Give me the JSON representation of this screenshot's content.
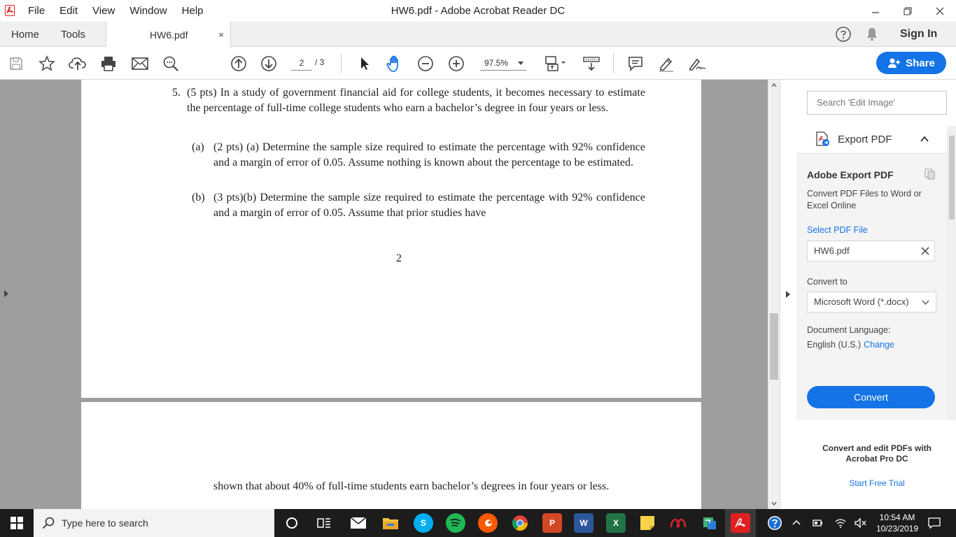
{
  "window": {
    "title": "HW6.pdf - Adobe Acrobat Reader DC",
    "menu": [
      "File",
      "Edit",
      "View",
      "Window",
      "Help"
    ]
  },
  "tabs": {
    "home": "Home",
    "tools": "Tools",
    "document": "HW6.pdf",
    "close_glyph": "×",
    "sign_in": "Sign In"
  },
  "toolbar": {
    "page_current": "2",
    "page_total": "/ 3",
    "zoom": "97.5%",
    "share_label": "Share"
  },
  "document": {
    "problem_number": "5.",
    "problem_text": "(5 pts) In a study of government financial aid for college students, it becomes necessary to estimate the percentage of full-time college students who earn a bachelor’s degree in four years or less.",
    "part_a_label": "(a)",
    "part_a_text": "(2 pts) (a) Determine the sample size required to estimate the percentage with 92% confidence and a margin of error of 0.05. Assume nothing is known about the percentage to be estimated.",
    "part_b_label": "(b)",
    "part_b_text": "(3 pts)(b) Determine the sample size required to estimate the percentage with 92% confidence and a margin of error of 0.05. Assume that prior studies have",
    "page_number": "2",
    "continuation_text": "shown that about 40% of full-time students earn bachelor’s degrees in four years or less."
  },
  "right_panel": {
    "search_placeholder": "Search 'Edit Image'",
    "export_title": "Export PDF",
    "section_title": "Adobe Export PDF",
    "description": "Convert PDF Files to Word or Excel Online",
    "select_file_label": "Select PDF File",
    "selected_file": "HW6.pdf",
    "convert_to_label": "Convert to",
    "format": "Microsoft Word (*.docx)",
    "language_label": "Document Language:",
    "language": "English (U.S.)",
    "change_link": "Change",
    "convert_button": "Convert",
    "promo": "Convert and edit PDFs with Acrobat Pro DC",
    "trial_link": "Start Free Trial"
  },
  "taskbar": {
    "search_placeholder": "Type here to search",
    "time": "10:54 AM",
    "date": "10/23/2019"
  },
  "colors": {
    "accent": "#1473e6",
    "acrobat_red": "#e02020",
    "taskbar": "#1c1c1c"
  }
}
